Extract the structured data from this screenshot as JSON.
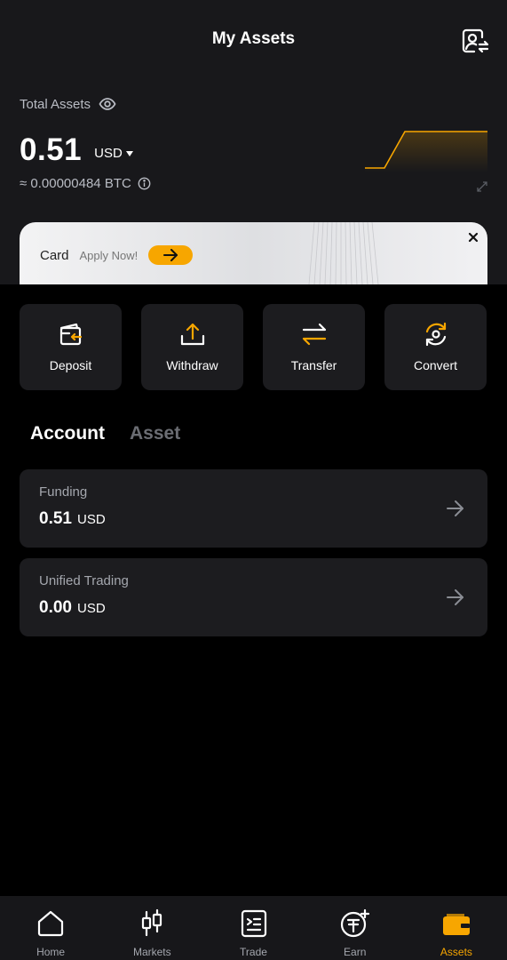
{
  "header": {
    "title": "My Assets",
    "profile_icon": "profile-switch-icon"
  },
  "overview": {
    "total_label": "Total Assets",
    "balance": "0.51",
    "currency": "USD",
    "btc_equiv": "≈ 0.00000484 BTC",
    "sparkline_color": "#f7a600"
  },
  "promo": {
    "card_label": "Card",
    "cta_text": "Apply Now!",
    "accent": "#f7a600"
  },
  "actions": [
    {
      "label": "Deposit",
      "icon": "deposit-icon"
    },
    {
      "label": "Withdraw",
      "icon": "withdraw-icon"
    },
    {
      "label": "Transfer",
      "icon": "transfer-icon"
    },
    {
      "label": "Convert",
      "icon": "convert-icon"
    }
  ],
  "tabs": [
    {
      "label": "Account",
      "active": true
    },
    {
      "label": "Asset",
      "active": false
    }
  ],
  "accounts": [
    {
      "name": "Funding",
      "amount": "0.51",
      "currency": "USD"
    },
    {
      "name": "Unified Trading",
      "amount": "0.00",
      "currency": "USD"
    }
  ],
  "nav": [
    {
      "label": "Home",
      "icon": "home-icon",
      "active": false
    },
    {
      "label": "Markets",
      "icon": "markets-icon",
      "active": false
    },
    {
      "label": "Trade",
      "icon": "trade-icon",
      "active": false
    },
    {
      "label": "Earn",
      "icon": "earn-icon",
      "active": false
    },
    {
      "label": "Assets",
      "icon": "wallet-icon",
      "active": true
    }
  ],
  "colors": {
    "accent": "#f7a600",
    "background": "#000000",
    "card": "#1c1c1f",
    "muted": "#a4a7ae"
  }
}
